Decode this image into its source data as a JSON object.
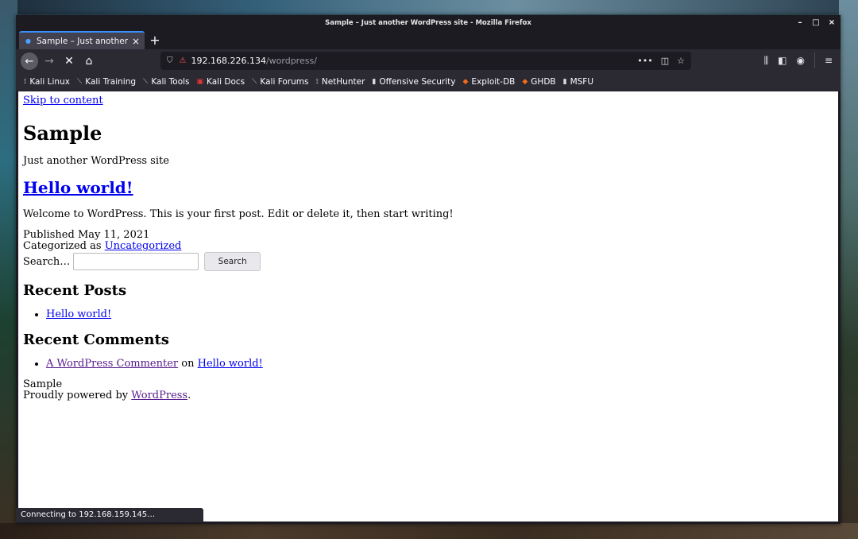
{
  "window": {
    "title": "Sample – Just another WordPress site - Mozilla Firefox",
    "controls": {
      "minimize": "–",
      "maximize": "□",
      "close": "×"
    }
  },
  "tab": {
    "title": "Sample – Just another W",
    "close": "×",
    "new_tab": "+"
  },
  "urlbar": {
    "host": "192.168.226.134",
    "path": "/wordpress/",
    "more": "•••"
  },
  "bookmarks": [
    "Kali Linux",
    "Kali Training",
    "Kali Tools",
    "Kali Docs",
    "Kali Forums",
    "NetHunter",
    "Offensive Security",
    "Exploit-DB",
    "GHDB",
    "MSFU"
  ],
  "page": {
    "skip_link": "Skip to content",
    "site_title": "Sample",
    "tagline": "Just another WordPress site",
    "post_title": "Hello world!",
    "post_body": "Welcome to WordPress. This is your first post. Edit or delete it, then start writing!",
    "published": "Published May 11, 2021",
    "categorized_prefix": "Categorized as",
    "category": "Uncategorized",
    "search_label": "Search…",
    "search_button": "Search",
    "recent_posts_title": "Recent Posts",
    "recent_posts": [
      "Hello world!"
    ],
    "recent_comments_title": "Recent Comments",
    "comment_author": "A WordPress Commenter",
    "comment_on": "on",
    "comment_post": "Hello world!",
    "footer_site": "Sample",
    "powered_prefix": "Proudly powered by",
    "powered_link": "WordPress",
    "powered_suffix": "."
  },
  "status": {
    "text": "Connecting to 192.168.159.145…"
  },
  "colors": {
    "tab_accent": "#3b8fff",
    "link": "#0000ee",
    "visited": "#551a8b",
    "chrome": "#2b2a33"
  }
}
